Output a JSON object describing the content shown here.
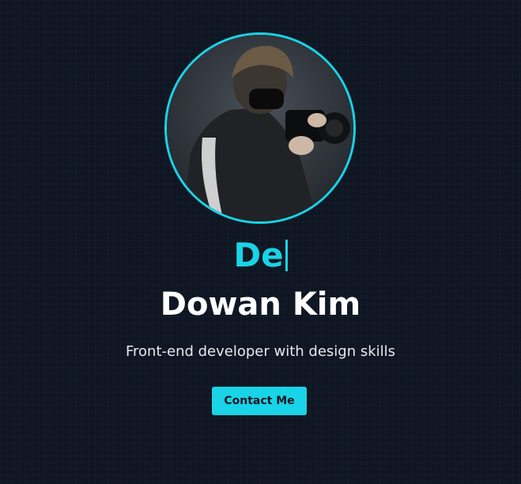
{
  "hero": {
    "typed_text": "De",
    "name": "Dowan Kim",
    "tagline": "Front-end developer with design skills",
    "contact_label": "Contact Me"
  },
  "colors": {
    "accent": "#19d3e6",
    "background": "#0f1623",
    "text": "#ffffff"
  },
  "icons": {
    "avatar": "profile-photo"
  }
}
